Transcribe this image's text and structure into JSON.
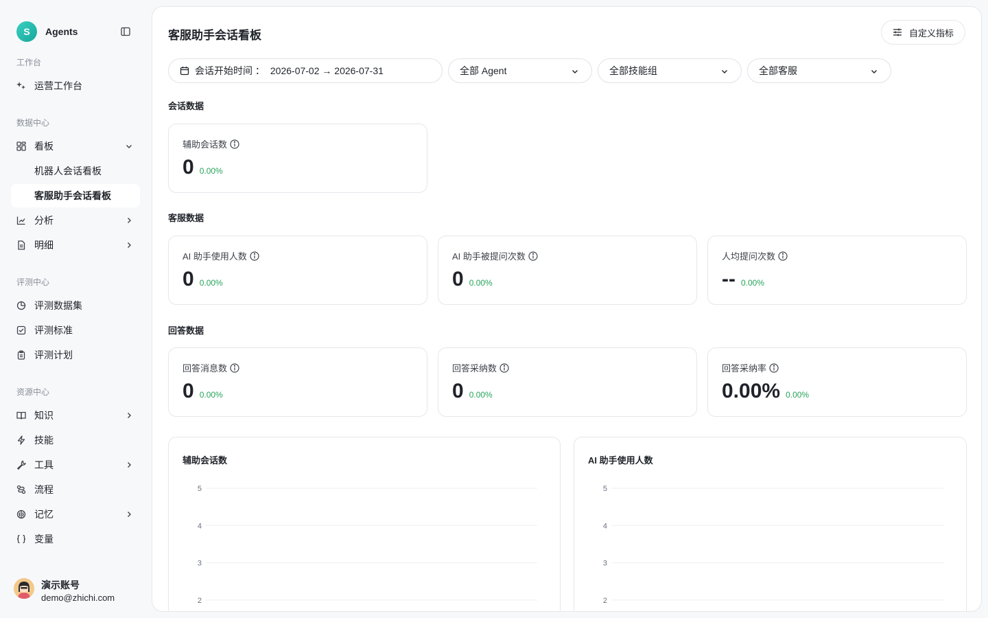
{
  "brand": {
    "logo_letter": "S",
    "name": "Agents"
  },
  "sidebar": {
    "sections": [
      {
        "label": "工作台",
        "items": [
          {
            "label": "运营工作台",
            "icon": "sparkle-icon"
          }
        ]
      },
      {
        "label": "数据中心",
        "items": [
          {
            "label": "看板",
            "icon": "dashboard-icon",
            "expanded": true,
            "children": [
              {
                "label": "机器人会话看板"
              },
              {
                "label": "客服助手会话看板",
                "active": true
              }
            ]
          },
          {
            "label": "分析",
            "icon": "line-chart-icon",
            "has_arrow": true
          },
          {
            "label": "明细",
            "icon": "document-icon",
            "has_arrow": true
          }
        ]
      },
      {
        "label": "评测中心",
        "items": [
          {
            "label": "评测数据集",
            "icon": "pie-icon"
          },
          {
            "label": "评测标准",
            "icon": "checkbox-icon"
          },
          {
            "label": "评测计划",
            "icon": "clipboard-icon"
          }
        ]
      },
      {
        "label": "资源中心",
        "items": [
          {
            "label": "知识",
            "icon": "book-icon",
            "has_arrow": true
          },
          {
            "label": "技能",
            "icon": "lightning-icon"
          },
          {
            "label": "工具",
            "icon": "wrench-icon",
            "has_arrow": true
          },
          {
            "label": "流程",
            "icon": "flow-icon"
          },
          {
            "label": "记忆",
            "icon": "brain-icon",
            "has_arrow": true
          },
          {
            "label": "变量",
            "icon": "braces-icon"
          }
        ]
      }
    ]
  },
  "user": {
    "name": "演示账号",
    "email": "demo@zhichi.com"
  },
  "header": {
    "title": "客服助手会话看板",
    "custom_button": "自定义指标"
  },
  "filters": {
    "date_label": "会话开始时间 ：",
    "date_range": "2026-07-02 → 2026-07-31",
    "agent": "全部 Agent",
    "skill_group": "全部技能组",
    "service": "全部客服"
  },
  "groups": {
    "session": {
      "title": "会话数据",
      "cards": [
        {
          "label": "辅助会话数",
          "value": "0",
          "delta": "0.00%"
        }
      ]
    },
    "service": {
      "title": "客服数据",
      "cards": [
        {
          "label": "AI 助手使用人数",
          "value": "0",
          "delta": "0.00%"
        },
        {
          "label": "AI 助手被提问次数",
          "value": "0",
          "delta": "0.00%"
        },
        {
          "label": "人均提问次数",
          "value": "--",
          "delta": "0.00%"
        }
      ]
    },
    "answer": {
      "title": "回答数据",
      "cards": [
        {
          "label": "回答消息数",
          "value": "0",
          "delta": "0.00%"
        },
        {
          "label": "回答采纳数",
          "value": "0",
          "delta": "0.00%"
        },
        {
          "label": "回答采纳率",
          "value": "0.00%",
          "delta": "0.00%"
        }
      ]
    }
  },
  "chart_data": [
    {
      "type": "line",
      "title": "辅助会话数",
      "yticks": [
        5,
        4,
        3,
        2
      ],
      "series": []
    },
    {
      "type": "line",
      "title": "AI 助手使用人数",
      "yticks": [
        5,
        4,
        3,
        2
      ],
      "series": []
    }
  ],
  "colors": {
    "accent": "#16a79b",
    "positive": "#27a35a",
    "grid": "#eceef1"
  }
}
